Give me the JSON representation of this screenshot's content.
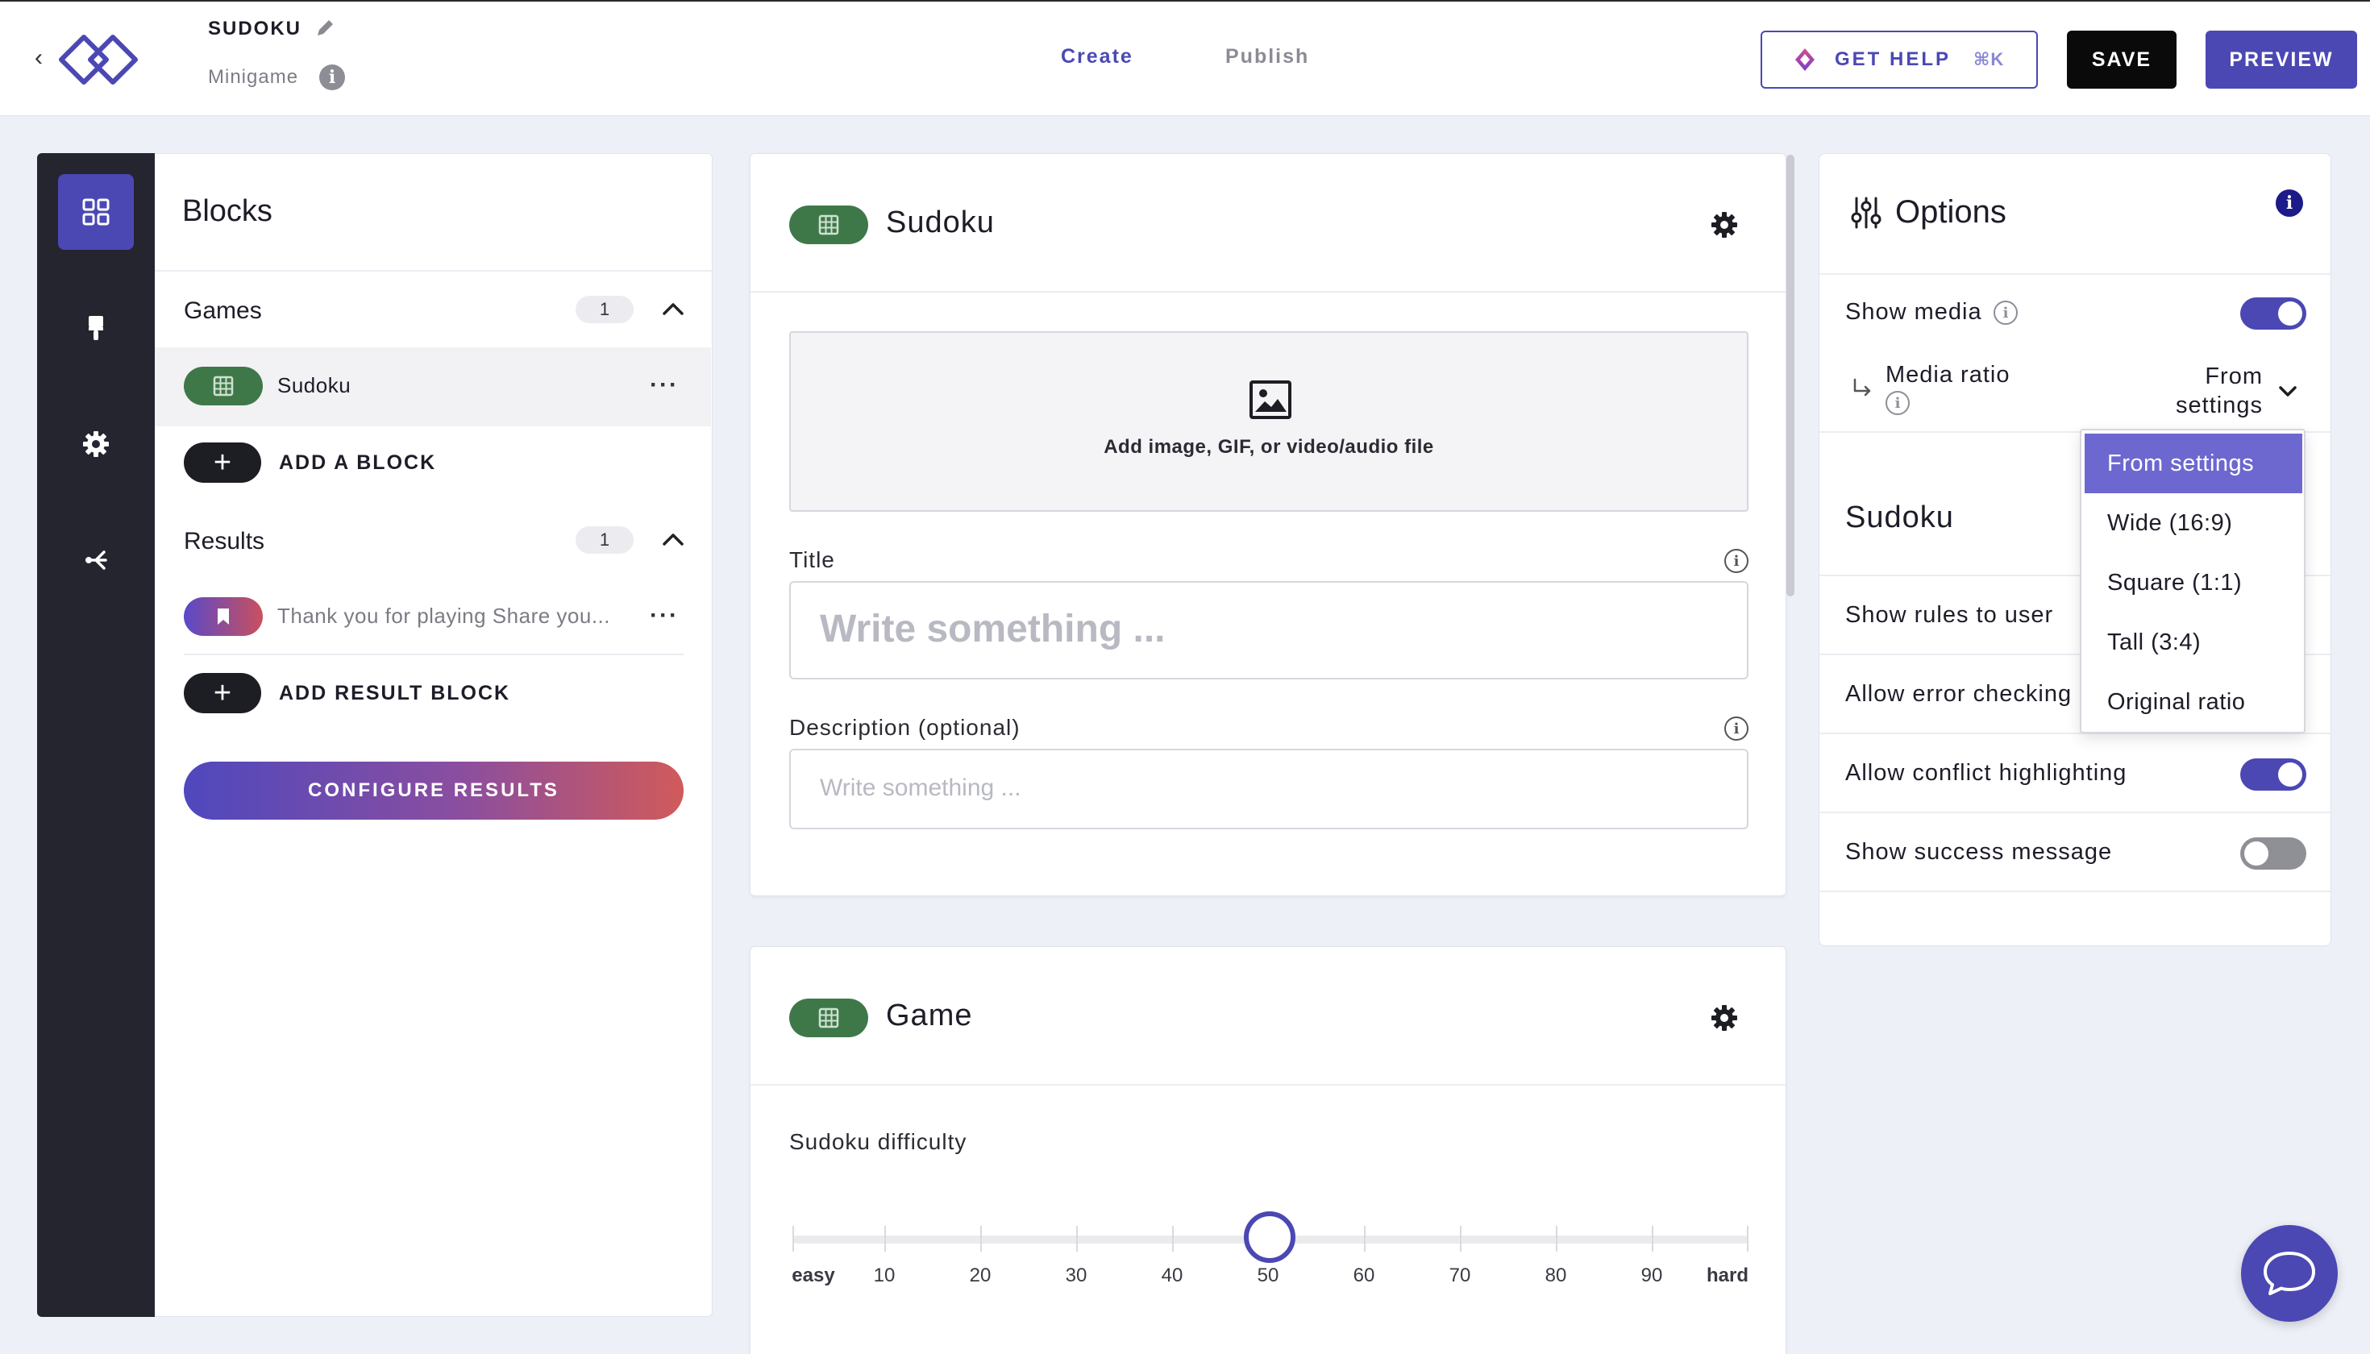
{
  "header": {
    "project_title": "SUDOKU",
    "project_type": "Minigame",
    "tabs": [
      "Create",
      "Publish"
    ],
    "help_label": "GET HELP",
    "help_shortcut": "⌘K",
    "save_label": "SAVE",
    "preview_label": "PREVIEW"
  },
  "rail": {
    "items": [
      "blocks-icon",
      "brush-icon",
      "gear-icon",
      "share-icon"
    ],
    "active": "blocks-icon"
  },
  "blocks_panel": {
    "title": "Blocks",
    "games": {
      "label": "Games",
      "count": "1",
      "items": [
        {
          "label": "Sudoku",
          "icon": "grid-icon",
          "color": "#3f7848"
        }
      ],
      "add_label": "ADD A BLOCK"
    },
    "results": {
      "label": "Results",
      "count": "1",
      "items": [
        {
          "label": "Thank you for playing Share you...",
          "icon": "bookmark-icon"
        }
      ],
      "add_label": "ADD RESULT BLOCK"
    },
    "configure_label": "CONFIGURE RESULTS"
  },
  "sudoku_card": {
    "title": "Sudoku",
    "media_text": "Add image, GIF, or video/audio file",
    "title_label": "Title",
    "title_placeholder": "Write something ...",
    "description_label": "Description (optional)",
    "description_placeholder": "Write something ..."
  },
  "game_card": {
    "title": "Game",
    "difficulty_label": "Sudoku difficulty",
    "difficulty_value": 50,
    "slider_labels": [
      "easy",
      "10",
      "20",
      "30",
      "40",
      "50",
      "60",
      "70",
      "80",
      "90",
      "hard"
    ]
  },
  "options_panel": {
    "title": "Options",
    "show_media": {
      "label": "Show media",
      "on": true
    },
    "media_ratio": {
      "label": "Media ratio",
      "value_line1": "From",
      "value_line2": "settings"
    },
    "section_title": "Sudoku",
    "show_rules": {
      "label": "Show rules to user"
    },
    "allow_error": {
      "label": "Allow error checking"
    },
    "allow_conflict": {
      "label": "Allow conflict highlighting",
      "on": true
    },
    "show_success": {
      "label": "Show success message",
      "on": false
    }
  },
  "ratio_dropdown": {
    "options": [
      "From settings",
      "Wide (16:9)",
      "Square (1:1)",
      "Tall (3:4)",
      "Original ratio"
    ],
    "selected": "From settings"
  },
  "colors": {
    "accent": "#4b48b4",
    "game_green": "#3f7848",
    "rail_dark": "#24252f"
  }
}
